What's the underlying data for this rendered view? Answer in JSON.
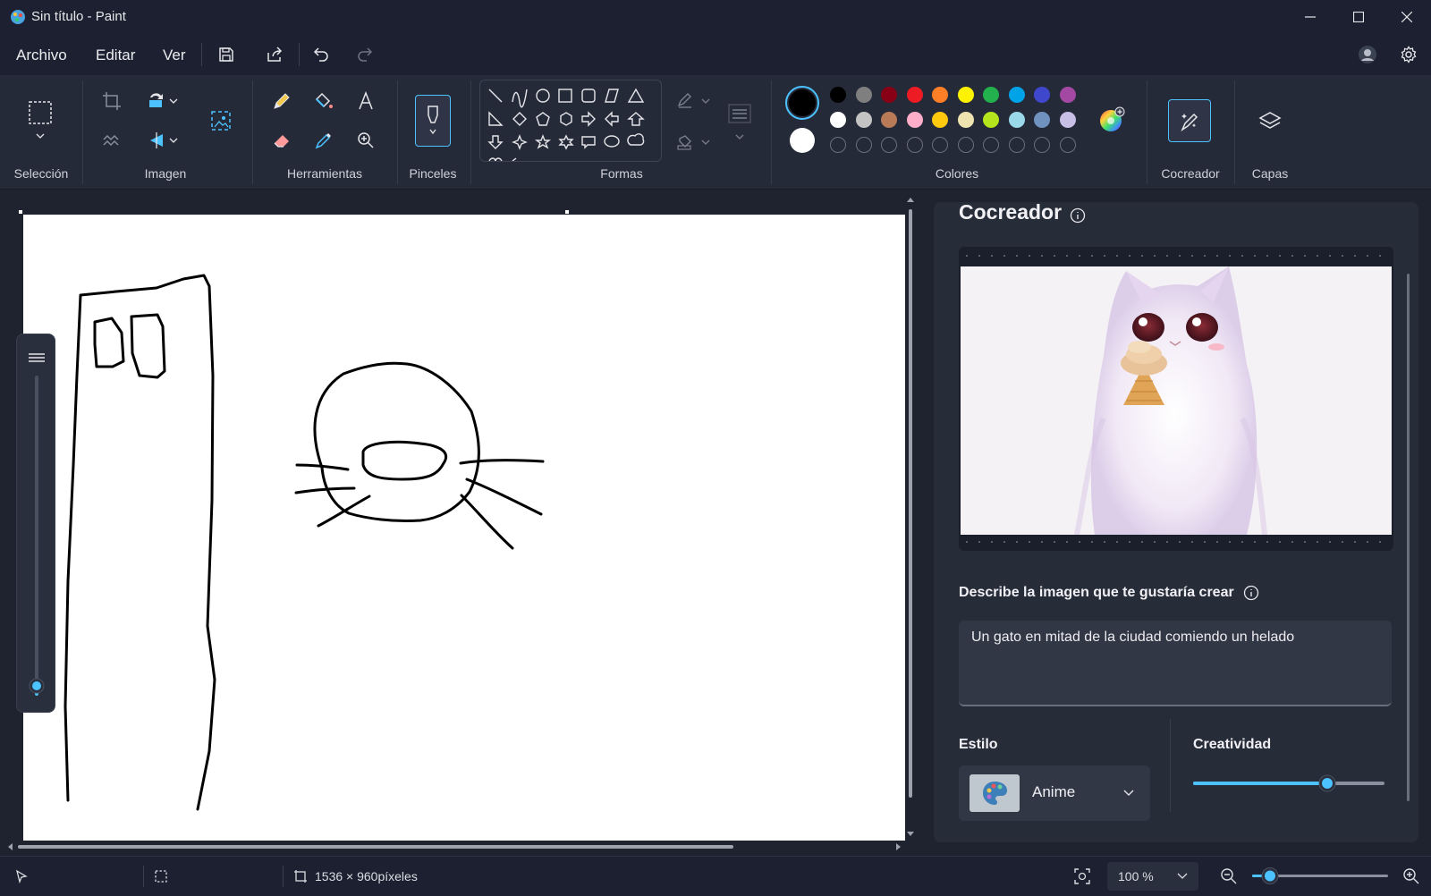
{
  "window": {
    "title": "Sin título - Paint"
  },
  "menu": {
    "file": "Archivo",
    "edit": "Editar",
    "view": "Ver"
  },
  "ribbon": {
    "groups": {
      "selection": "Selección",
      "image": "Imagen",
      "tools": "Herramientas",
      "brushes": "Pinceles",
      "shapes": "Formas",
      "colors": "Colores",
      "cocreator": "Cocreador",
      "layers": "Capas"
    },
    "palette": {
      "row1": [
        "#000000",
        "#7f7f7f",
        "#880015",
        "#ed1c24",
        "#ff7f27",
        "#fff200",
        "#22b14c",
        "#00a2e8",
        "#3f48cc",
        "#a349a4"
      ],
      "row2": [
        "#ffffff",
        "#c3c3c3",
        "#b97a57",
        "#ffaec9",
        "#ffc90e",
        "#efe4b0",
        "#b5e61d",
        "#99d9ea",
        "#7092be",
        "#c8bfe7"
      ],
      "empty_count": 10
    },
    "primary_color": "#000000",
    "secondary_color": "#ffffff",
    "accent": "#4cc2ff"
  },
  "cocreator": {
    "title": "Cocreador",
    "describe_label": "Describe la imagen que te gustaría crear",
    "prompt_value": "Un gato en mitad de la ciudad comiendo un helado",
    "style_label": "Estilo",
    "style_value": "Anime",
    "creativity_label": "Creatividad",
    "creativity_level": 0.7
  },
  "status": {
    "dimensions": "1536 × 960píxeles",
    "zoom": "100 %"
  },
  "icons": {
    "save": "save-icon",
    "share": "share-icon",
    "undo": "undo-icon",
    "redo": "redo-icon",
    "settings": "gear-icon"
  }
}
